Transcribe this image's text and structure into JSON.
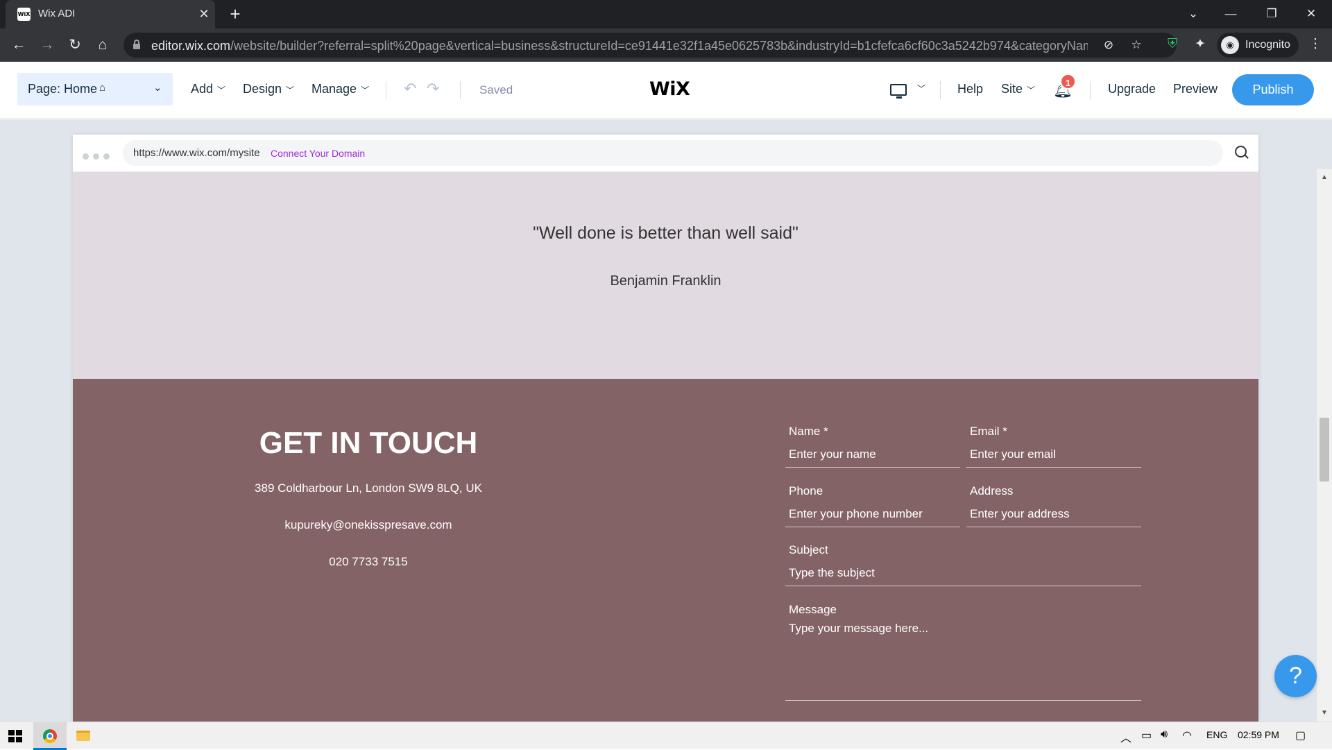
{
  "browser": {
    "tab_title": "Wix ADI",
    "tab_favicon": "WiX",
    "url_host": "editor.wix.com",
    "url_path": "/website/builder?referral=split%20page&vertical=business&structureId=ce91441e32f1a45e0625783b&industryId=b1cfefca6cf60c3a5242b974&categoryName...",
    "profile_label": "Incognito"
  },
  "editor": {
    "page_label": "Page: Home",
    "menu": {
      "add": "Add",
      "design": "Design",
      "manage": "Manage"
    },
    "saved_status": "Saved",
    "logo": "WiX",
    "right_menu": {
      "help": "Help",
      "site": "Site",
      "upgrade": "Upgrade",
      "preview": "Preview"
    },
    "notifications_count": "1",
    "publish_label": "Publish"
  },
  "site_frame": {
    "url": "https://www.wix.com/mysite",
    "connect_domain": "Connect Your Domain"
  },
  "quote": {
    "text": "\"Well done is better than well said\"",
    "author": "Benjamin Franklin"
  },
  "contact": {
    "title": "GET IN TOUCH",
    "address": "389 Coldharbour Ln, London SW9 8LQ, UK",
    "email": "kupureky@onekisspresave.com",
    "phone": "020 7733 7515"
  },
  "form": {
    "name_label": "Name *",
    "name_placeholder": "Enter your name",
    "email_label": "Email *",
    "email_placeholder": "Enter your email",
    "phone_label": "Phone",
    "phone_placeholder": "Enter your phone number",
    "address_label": "Address",
    "address_placeholder": "Enter your address",
    "subject_label": "Subject",
    "subject_placeholder": "Type the subject",
    "message_label": "Message",
    "message_placeholder": "Type your message here..."
  },
  "help_button": "?",
  "taskbar": {
    "language": "ENG",
    "time": "02:59 PM"
  },
  "colors": {
    "accent": "#3899ec",
    "quote_bg": "#e1dbe1",
    "contact_bg": "#846366",
    "badge": "#ee5951"
  }
}
